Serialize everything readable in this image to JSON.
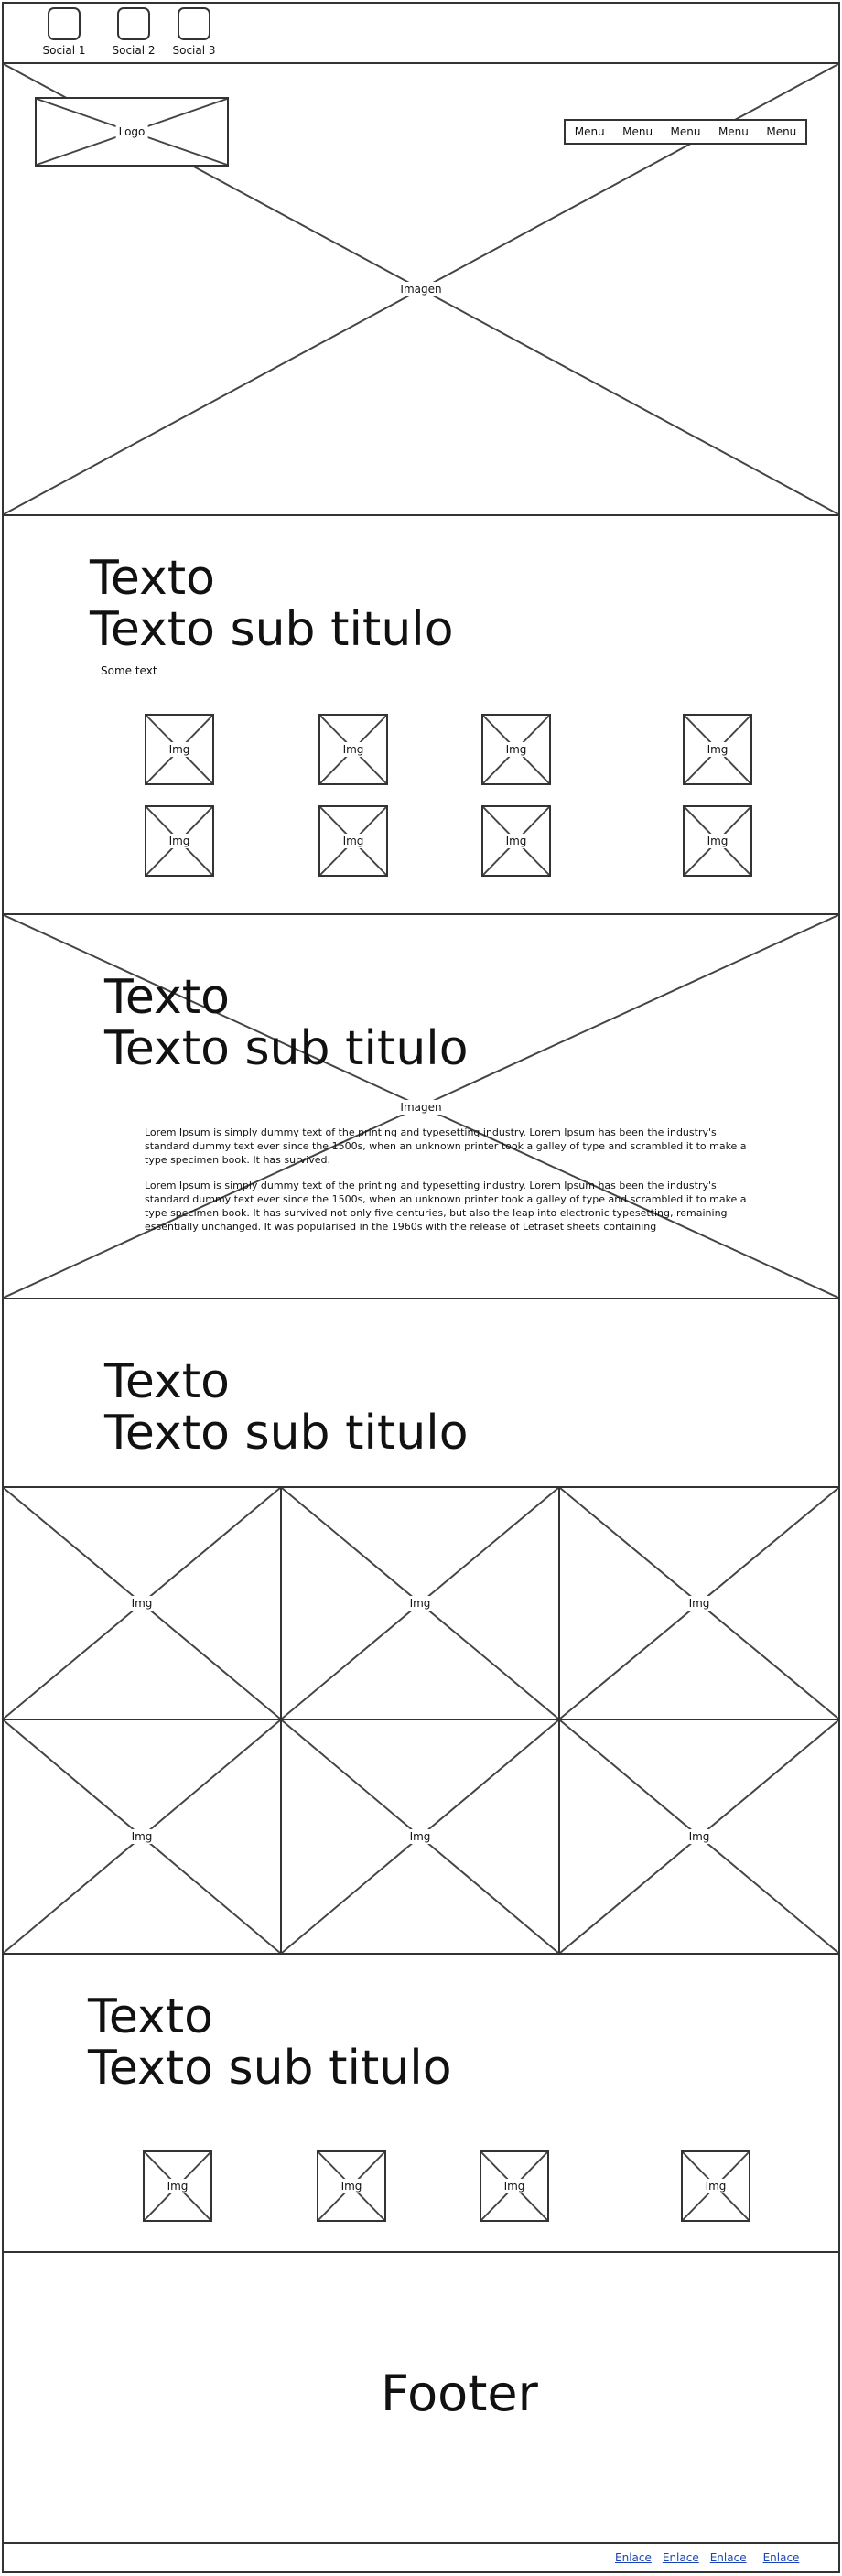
{
  "social": [
    {
      "label": "Social 1"
    },
    {
      "label": "Social 2"
    },
    {
      "label": "Social 3"
    }
  ],
  "header": {
    "logo": "Logo",
    "hero_image": "Imagen",
    "menu": [
      "Menu",
      "Menu",
      "Menu",
      "Menu",
      "Menu"
    ]
  },
  "section1": {
    "title": "Texto",
    "subtitle": "Texto sub titulo",
    "text": "Some text",
    "images": [
      "Img",
      "Img",
      "Img",
      "Img",
      "Img",
      "Img",
      "Img",
      "Img"
    ]
  },
  "section2": {
    "title": "Texto",
    "subtitle": "Texto sub titulo",
    "bg_image": "Imagen",
    "paragraphs": [
      "Lorem Ipsum is simply dummy text of the printing and typesetting industry. Lorem Ipsum has been the industry's standard dummy text ever since the 1500s, when an unknown printer took a galley of type and scrambled it to make a type specimen book. It has survived.",
      "Lorem Ipsum is simply dummy text of the printing and typesetting industry. Lorem Ipsum has been the industry's standard dummy text ever since the 1500s, when an unknown printer took a galley of type and scrambled it to make a type specimen book. It has survived not only five centuries, but also the leap into electronic typesetting, remaining essentially unchanged. It was popularised in the 1960s with the release of Letraset sheets containing"
    ]
  },
  "section3": {
    "title": "Texto",
    "subtitle": "Texto sub titulo",
    "grid": [
      "Img",
      "Img",
      "Img",
      "Img",
      "Img",
      "Img"
    ]
  },
  "section4": {
    "title": "Texto",
    "subtitle": "Texto sub titulo",
    "images": [
      "Img",
      "Img",
      "Img",
      "Img"
    ]
  },
  "footer": {
    "title": "Footer",
    "links": [
      "Enlace",
      "Enlace",
      "Enlace",
      "Enlace"
    ]
  }
}
